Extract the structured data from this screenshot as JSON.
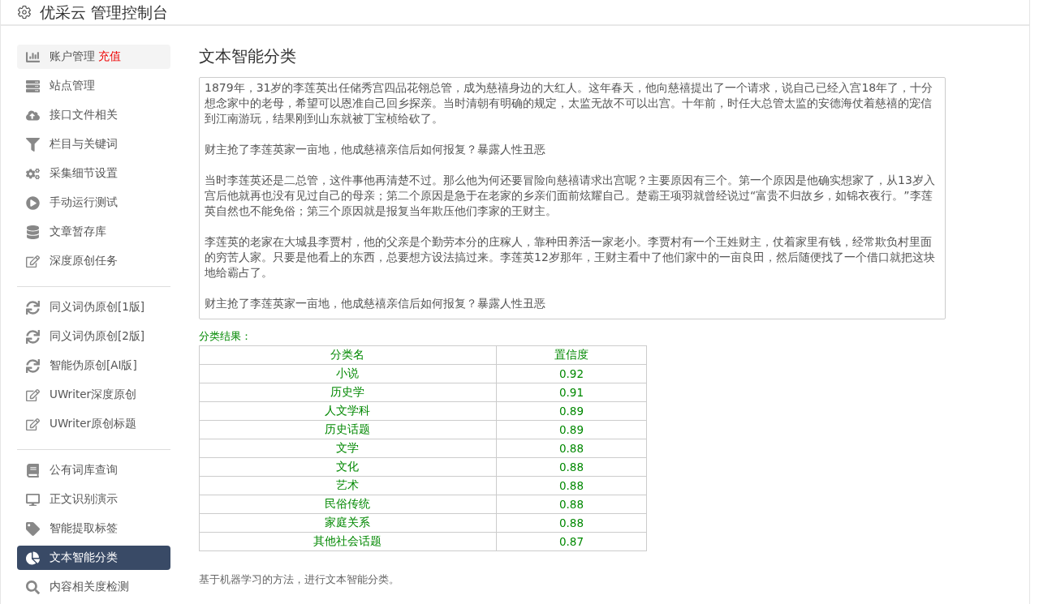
{
  "header": {
    "title": "优采云 管理控制台"
  },
  "sidebar": {
    "groups": [
      [
        {
          "label": "账户管理",
          "badge": "充值",
          "kind": "chart",
          "selected": false
        },
        {
          "label": "站点管理",
          "kind": "server",
          "selected": false
        },
        {
          "label": "接口文件相关",
          "kind": "cloud",
          "selected": false
        },
        {
          "label": "栏目与关键词",
          "kind": "filter",
          "selected": false
        },
        {
          "label": "采集细节设置",
          "kind": "cogs",
          "selected": false
        },
        {
          "label": "手动运行测试",
          "kind": "play",
          "selected": false
        },
        {
          "label": "文章暂存库",
          "kind": "database",
          "selected": false
        },
        {
          "label": "深度原创任务",
          "kind": "edit",
          "selected": false
        }
      ],
      [
        {
          "label": "同义词伪原创[1版]",
          "kind": "sync",
          "selected": false
        },
        {
          "label": "同义词伪原创[2版]",
          "kind": "sync",
          "selected": false
        },
        {
          "label": "智能伪原创[AI版]",
          "kind": "sync",
          "selected": false
        },
        {
          "label": "UWriter深度原创",
          "kind": "edit",
          "selected": false
        },
        {
          "label": "UWriter原创标题",
          "kind": "edit",
          "selected": false
        }
      ],
      [
        {
          "label": "公有词库查询",
          "kind": "book",
          "selected": false
        },
        {
          "label": "正文识别演示",
          "kind": "desktop",
          "selected": false
        },
        {
          "label": "智能提取标签",
          "kind": "tag",
          "selected": false
        },
        {
          "label": "文本智能分类",
          "kind": "pie",
          "selected": true
        },
        {
          "label": "内容相关度检测",
          "kind": "search",
          "selected": false
        }
      ]
    ]
  },
  "main": {
    "heading": "文本智能分类",
    "text_input": {
      "paragraphs": [
        "1879年，31岁的李莲英出任储秀宫四品花翎总管，成为慈禧身边的大红人。这年春天，他向慈禧提出了一个请求，说自己已经入宫18年了，十分想念家中的老母，希望可以恩准自己回乡探亲。当时清朝有明确的规定，太监无故不可以出宫。十年前，时任大总管太监的安德海仗着慈禧的宠信到江南游玩，结果刚到山东就被丁宝桢给砍了。",
        "财主抢了李莲英家一亩地，他成慈禧亲信后如何报复？暴露人性丑恶",
        "当时李莲英还是二总管，这件事他再清楚不过。那么他为何还要冒险向慈禧请求出宫呢？主要原因有三个。第一个原因是他确实想家了，从13岁入宫后他就再也没有见过自己的母亲；第二个原因是急于在老家的乡亲们面前炫耀自己。楚霸王项羽就曾经说过“富贵不归故乡，如锦衣夜行。”李莲英自然也不能免俗；第三个原因就是报复当年欺压他们李家的王财主。",
        "李莲英的老家在大城县李贾村，他的父亲是个勤劳本分的庄稼人，靠种田养活一家老小。李贾村有一个王姓财主，仗着家里有钱，经常欺负村里面的穷苦人家。只要是他看上的东西，总要想方设法搞过来。李莲英12岁那年，王财主看中了他们家中的一亩良田，然后随便找了一个借口就把这块地给霸占了。",
        "财主抢了李莲英家一亩地，他成慈禧亲信后如何报复？暴露人性丑恶"
      ]
    },
    "result_label": "分类结果：",
    "table": {
      "columns": [
        "分类名",
        "置信度"
      ],
      "rows": [
        [
          "小说",
          "0.92"
        ],
        [
          "历史学",
          "0.91"
        ],
        [
          "人文学科",
          "0.89"
        ],
        [
          "历史话题",
          "0.89"
        ],
        [
          "文学",
          "0.88"
        ],
        [
          "文化",
          "0.88"
        ],
        [
          "艺术",
          "0.88"
        ],
        [
          "民俗传统",
          "0.88"
        ],
        [
          "家庭关系",
          "0.88"
        ],
        [
          "其他社会话题",
          "0.87"
        ]
      ]
    },
    "note": "基于机器学习的方法，进行文本智能分类。"
  }
}
